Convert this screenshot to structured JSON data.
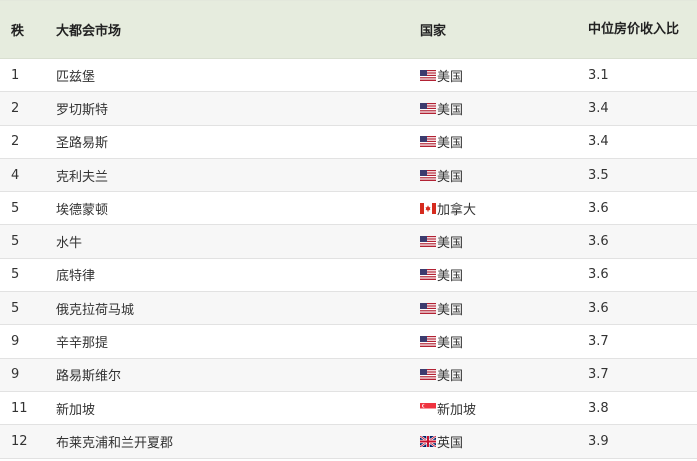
{
  "table": {
    "headers": {
      "rank": "秩",
      "city": "大都会市场",
      "country": "国家",
      "ratio": "中位房价收入比"
    },
    "rows": [
      {
        "rank": "1",
        "city": "匹兹堡",
        "flag": "us-flag-icon",
        "country": "美国",
        "ratio": "3.1"
      },
      {
        "rank": "2",
        "city": "罗切斯特",
        "flag": "us-flag-icon",
        "country": "美国",
        "ratio": "3.4"
      },
      {
        "rank": "2",
        "city": "圣路易斯",
        "flag": "us-flag-icon",
        "country": "美国",
        "ratio": "3.4"
      },
      {
        "rank": "4",
        "city": "克利夫兰",
        "flag": "us-flag-icon",
        "country": "美国",
        "ratio": "3.5"
      },
      {
        "rank": "5",
        "city": "埃德蒙顿",
        "flag": "canada-flag-icon",
        "country": "加拿大",
        "ratio": "3.6"
      },
      {
        "rank": "5",
        "city": "水牛",
        "flag": "us-flag-icon",
        "country": "美国",
        "ratio": "3.6"
      },
      {
        "rank": "5",
        "city": "底特律",
        "flag": "us-flag-icon",
        "country": "美国",
        "ratio": "3.6"
      },
      {
        "rank": "5",
        "city": "俄克拉荷马城",
        "flag": "us-flag-icon",
        "country": "美国",
        "ratio": "3.6"
      },
      {
        "rank": "9",
        "city": "辛辛那提",
        "flag": "us-flag-icon",
        "country": "美国",
        "ratio": "3.7"
      },
      {
        "rank": "9",
        "city": "路易斯维尔",
        "flag": "us-flag-icon",
        "country": "美国",
        "ratio": "3.7"
      },
      {
        "rank": "11",
        "city": "新加坡",
        "flag": "singapore-flag-icon",
        "country": "新加坡",
        "ratio": "3.8"
      },
      {
        "rank": "12",
        "city": "布莱克浦和兰开夏郡",
        "flag": "uk-flag-icon",
        "country": "英国",
        "ratio": "3.9"
      }
    ]
  },
  "colors": {
    "header_bg": "#e6ecde",
    "alt_row_bg": "#f7f7f7",
    "border": "#e2e2e2"
  }
}
